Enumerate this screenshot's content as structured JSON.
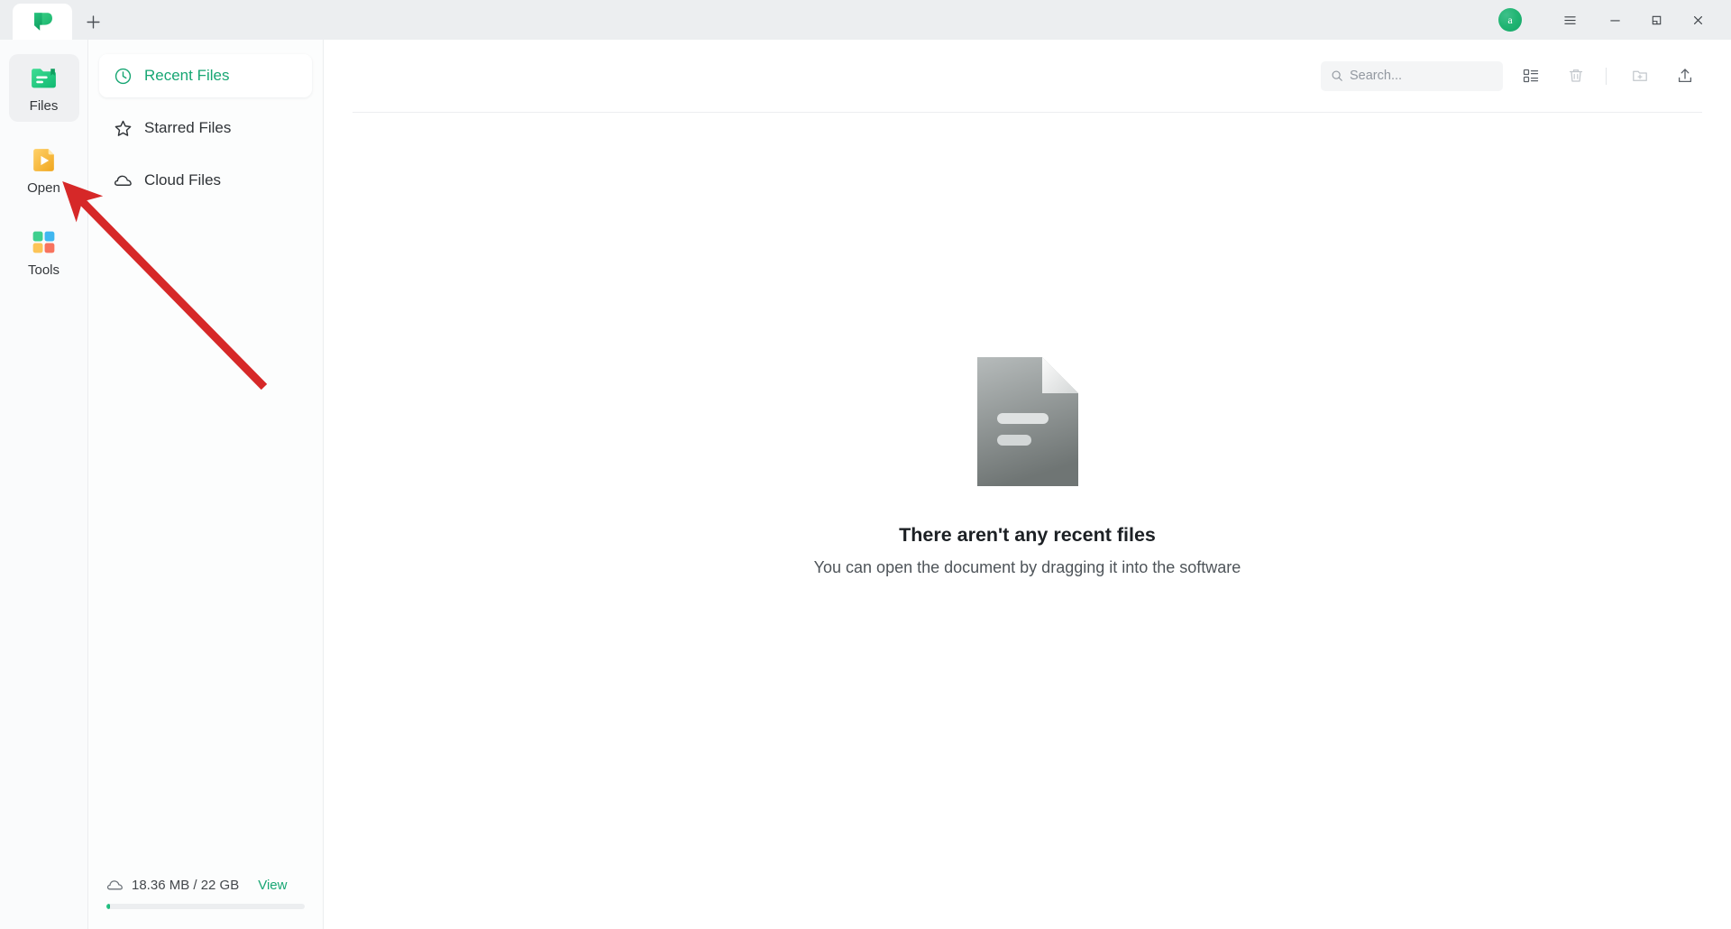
{
  "window": {
    "app_logo": "wps-logo",
    "tab_add_label": "+",
    "avatar_letter": "a",
    "controls": {
      "menu": "menu-hamburger",
      "minimize": "minimize",
      "restore": "restore",
      "close": "close"
    }
  },
  "rail": {
    "items": [
      {
        "label": "Files",
        "icon": "files-folder-icon",
        "active": true
      },
      {
        "label": "Open",
        "icon": "open-document-icon",
        "active": false
      },
      {
        "label": "Tools",
        "icon": "tools-grid-icon",
        "active": false
      }
    ]
  },
  "filenav": {
    "items": [
      {
        "label": "Recent Files",
        "icon": "clock-icon",
        "active": true
      },
      {
        "label": "Starred Files",
        "icon": "star-icon",
        "active": false
      },
      {
        "label": "Cloud Files",
        "icon": "cloud-icon",
        "active": false
      }
    ],
    "storage": {
      "icon": "cloud-icon",
      "usage_text": "18.36 MB / 22 GB",
      "view_label": "View",
      "used_percent": 1.6
    }
  },
  "toolbar": {
    "search_placeholder": "Search...",
    "search_value": "",
    "buttons": [
      {
        "name": "list-view-toggle",
        "icon": "list-view-icon",
        "disabled": false
      },
      {
        "name": "recycle-bin",
        "icon": "trash-icon",
        "disabled": true
      },
      {
        "name": "new-folder",
        "icon": "new-folder-icon",
        "disabled": true
      },
      {
        "name": "upload",
        "icon": "upload-icon",
        "disabled": false
      }
    ]
  },
  "empty_state": {
    "illustration": "document-placeholder-icon",
    "title": "There aren't any recent files",
    "subtitle": "You can open the document by dragging it into the software"
  },
  "annotation": {
    "type": "arrow",
    "color": "#d62828",
    "points_to": "rail-item-open"
  },
  "colors": {
    "accent_green": "#17a673",
    "titlebar_bg": "#eceef0",
    "panel_bg": "#fcfdfd",
    "annotation_red": "#d62828"
  }
}
